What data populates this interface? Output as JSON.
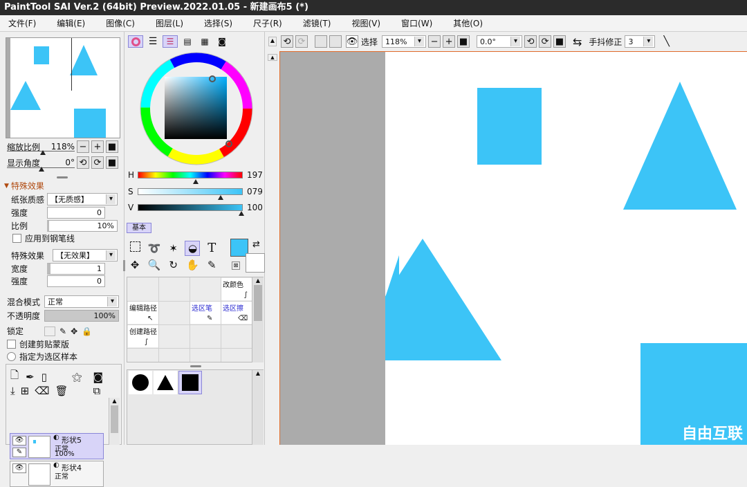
{
  "window": {
    "title": "PaintTool SAI Ver.2 (64bit) Preview.2022.01.05 - 新建画布5 (*)"
  },
  "menu": [
    "文件(F)",
    "编辑(E)",
    "图像(C)",
    "图层(L)",
    "选择(S)",
    "尺子(R)",
    "滤镜(T)",
    "视图(V)",
    "窗口(W)",
    "其他(O)"
  ],
  "navigator": {
    "zoom_label": "缩放比例",
    "zoom_value": "118%",
    "angle_label": "显示角度",
    "angle_value": "0°"
  },
  "effects": {
    "header": "特殊效果",
    "paper_label": "纸张质感",
    "paper_value": "【无质感】",
    "strength_label": "强度",
    "strength_value": "0",
    "scale_label": "比例",
    "scale_value": "10%",
    "apply_pen_label": "应用到钢笔线",
    "effect_label": "特殊效果",
    "effect_value": "【无效果】",
    "width_label": "宽度",
    "width_value": "1",
    "strength2_label": "强度",
    "strength2_value": "0"
  },
  "layer_props": {
    "blend_label": "混合模式",
    "blend_value": "正常",
    "opacity_label": "不透明度",
    "opacity_value": "100%",
    "lock_label": "锁定",
    "clip_label": "创建剪贴蒙版",
    "sample_label": "指定为选区样本"
  },
  "layers": [
    {
      "name": "形状5",
      "mode": "正常",
      "opacity": "100%"
    },
    {
      "name": "形状4",
      "mode": "正常",
      "opacity": ""
    }
  ],
  "color": {
    "h_label": "H",
    "h_value": "197",
    "s_label": "S",
    "s_value": "079",
    "v_label": "V",
    "v_value": "100",
    "fg": "#3cc4f7",
    "bg": "#ffffff"
  },
  "tools": {
    "tab_label": "基本",
    "text_tool": "T",
    "brushes": [
      {
        "name": "改颜色"
      },
      {
        "name": "编辑路径"
      },
      {
        "name": "选区笔"
      },
      {
        "name": "选区擦"
      },
      {
        "name": "创建路径"
      }
    ]
  },
  "canvas_toolbar": {
    "select_label": "选择",
    "zoom_value": "118%",
    "angle_value": "0.0°",
    "stabilizer_label": "手抖修正",
    "stabilizer_value": "3"
  },
  "shape_color": "#3cc4f7",
  "watermark": "自由互联"
}
